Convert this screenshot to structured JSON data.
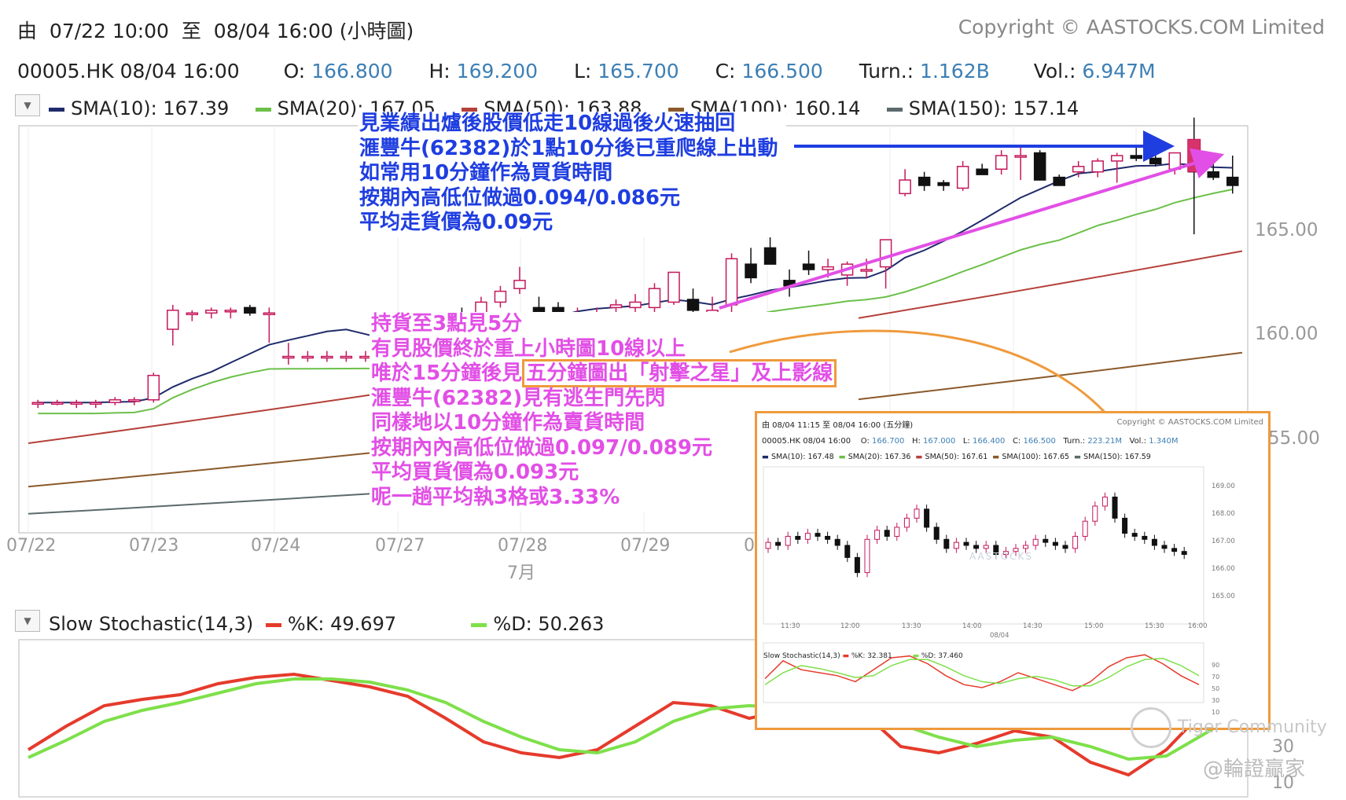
{
  "header": {
    "period_prefix": "由",
    "period_start": "07/22 10:00",
    "period_mid": "至",
    "period_end": "08/04 16:00 (小時圖)",
    "copyright": "Copyright © AASTOCKS.COM Limited",
    "symbol_time": "00005.HK 08/04 16:00",
    "open_label": "O:",
    "open_value": "166.800",
    "high_label": "H:",
    "high_value": "169.200",
    "low_label": "L:",
    "low_value": "165.700",
    "close_label": "C:",
    "close_value": "166.500",
    "turnover_label": "Turn.:",
    "turnover_value": "1.162B",
    "volume_label": "Vol.:",
    "volume_value": "6.947M"
  },
  "legend": [
    {
      "label": "SMA(10): 167.39",
      "color": "#1f2b6b"
    },
    {
      "label": "SMA(20): 167.05",
      "color": "#6cc04a"
    },
    {
      "label": "SMA(50): 163.88",
      "color": "#b5413a"
    },
    {
      "label": "SMA(100): 160.14",
      "color": "#8a5a2b"
    },
    {
      "label": "SMA(150): 157.14",
      "color": "#5b6b6b"
    }
  ],
  "annotation_blue": [
    "見業績出爐後股價低走10線過後火速抽回",
    "滙豐牛(62382)於1點10分後已重爬線上出動",
    "如常用10分鐘作為買貨時間",
    "按期內高低位做過0.094/0.086元",
    "平均走貨價為0.09元"
  ],
  "annotation_pink": {
    "line1": "持貨至3點見5分",
    "line2": "有見股價終於重上小時圖10線以上",
    "line3_a": "唯於15分鐘後見",
    "line3_b": "五分鐘圖出「射擊之星」及上影線",
    "line4": "滙豐牛(62382)見有逃生門先閃",
    "line5": "同樣地以10分鐘作為賣貨時間",
    "line6": "按期內內高低位做過0.097/0.089元",
    "line7": "平均買貨價為0.093元",
    "line8": "呢一趟平均執3格或3.33%"
  },
  "x_axis": {
    "labels": [
      "07/22",
      "07/23",
      "07/24",
      "07/27",
      "07/28",
      "07/29",
      "0"
    ],
    "month_label": "7月"
  },
  "y_axis": {
    "labels": [
      "165.00",
      "160.00",
      "55.00"
    ]
  },
  "stochastic": {
    "dropdown": "▼",
    "title": "Slow Stochastic(14,3)",
    "k_label": "%K: 49.697",
    "k_color": "#e53b2c",
    "d_label": "%D: 50.263",
    "d_color": "#7ee04a",
    "y_labels": [
      "30",
      "10"
    ]
  },
  "inset": {
    "title": "由 08/04 11:15 至 08/04 16:00 (五分鐘)",
    "copyright": "Copyright © AASTOCKS.COM Limited",
    "symbol_time": "00005.HK 08/04 16:00",
    "open": "O: ",
    "open_v": "166.700",
    "high": "H: ",
    "high_v": "167.000",
    "low": "L: ",
    "low_v": "166.400",
    "close": "C: ",
    "close_v": "166.500",
    "turn": "Turn.: ",
    "turn_v": "223.21M",
    "vol": "Vol.: ",
    "vol_v": "1.340M",
    "legend": [
      "SMA(10): 167.48",
      "SMA(20): 167.36",
      "SMA(50): 167.61",
      "SMA(100): 167.65",
      "SMA(150): 167.59"
    ],
    "y_labels": [
      "169.00",
      "168.00",
      "167.00",
      "166.00",
      "165.00"
    ],
    "x_labels": [
      "11:30",
      "12:00",
      "13:30",
      "14:00",
      "14:30",
      "15:00",
      "15:30",
      "16:00"
    ],
    "date_label": "08/04",
    "stoch_title": "Slow Stochastic(14,3)",
    "stoch_k": "%K: 32.381",
    "stoch_d": "%D: 37.460",
    "stoch_y": [
      "90",
      "70",
      "50",
      "30",
      "10"
    ],
    "watermark": "AASTOCKS"
  },
  "watermarks": {
    "tiger": "Tiger Community",
    "author": "@輪證贏家"
  },
  "chart_data": [
    {
      "type": "candlestick",
      "title": "00005.HK hourly",
      "period": "07/22 10:00 – 08/04 16:00",
      "ylim": [
        153.5,
        168.5
      ],
      "candles": [
        [
          158.3,
          158.4,
          158.1,
          158.3
        ],
        [
          158.3,
          158.4,
          158.2,
          158.3
        ],
        [
          158.3,
          158.4,
          158.1,
          158.3
        ],
        [
          158.3,
          158.4,
          158.1,
          158.3
        ],
        [
          158.3,
          158.5,
          158.2,
          158.4
        ],
        [
          158.4,
          158.5,
          158.2,
          158.4
        ],
        [
          158.4,
          159.4,
          158.3,
          159.3
        ],
        [
          161.0,
          161.9,
          160.4,
          161.7
        ],
        [
          161.6,
          161.7,
          161.3,
          161.6
        ],
        [
          161.6,
          161.8,
          161.4,
          161.7
        ],
        [
          161.7,
          161.8,
          161.4,
          161.7
        ],
        [
          161.8,
          161.9,
          161.5,
          161.6
        ],
        [
          161.6,
          161.8,
          160.5,
          161.6
        ],
        [
          160.0,
          160.5,
          159.7,
          160.0
        ],
        [
          160.0,
          160.2,
          159.8,
          160.0
        ],
        [
          160.0,
          160.2,
          159.8,
          160.0
        ],
        [
          160.0,
          160.2,
          159.8,
          160.0
        ],
        [
          160.0,
          160.2,
          159.8,
          160.0
        ],
        [
          160.0,
          160.3,
          159.7,
          159.8
        ],
        [
          160.5,
          161.0,
          160.2,
          160.6
        ],
        [
          161.2,
          161.5,
          160.9,
          161.4
        ],
        [
          161.2,
          161.6,
          161.0,
          161.5
        ],
        [
          161.6,
          161.8,
          161.2,
          161.3
        ],
        [
          161.4,
          162.2,
          161.3,
          162.0
        ],
        [
          162.0,
          162.6,
          161.8,
          162.4
        ],
        [
          162.5,
          163.3,
          162.3,
          162.8
        ],
        [
          161.8,
          162.2,
          161.5,
          161.6
        ],
        [
          161.8,
          162.0,
          161.4,
          161.4
        ],
        [
          161.4,
          161.8,
          161.3,
          161.6
        ],
        [
          161.6,
          161.8,
          161.4,
          161.6
        ],
        [
          161.8,
          162.1,
          161.6,
          161.9
        ],
        [
          161.8,
          162.3,
          161.6,
          162.0
        ],
        [
          161.8,
          162.7,
          161.5,
          162.5
        ],
        [
          162.0,
          163.0,
          161.9,
          163.1
        ],
        [
          162.1,
          162.5,
          161.6,
          161.7
        ],
        [
          161.6,
          162.2,
          161.4,
          161.7
        ],
        [
          161.9,
          163.8,
          161.6,
          163.6
        ],
        [
          163.4,
          164.0,
          162.7,
          162.9
        ],
        [
          164.0,
          164.8,
          163.8,
          163.4
        ],
        [
          162.8,
          163.2,
          162.2,
          162.6
        ],
        [
          163.4,
          163.9,
          163.0,
          163.2
        ],
        [
          163.2,
          163.6,
          162.9,
          163.3
        ],
        [
          163.0,
          163.5,
          162.6,
          163.4
        ],
        [
          163.2,
          163.6,
          162.9,
          163.2
        ],
        [
          163.3,
          164.3,
          162.5,
          164.3
        ],
        [
          166.0,
          166.9,
          165.9,
          166.5
        ],
        [
          166.6,
          166.8,
          166.1,
          166.3
        ],
        [
          166.4,
          166.5,
          166.1,
          166.3
        ],
        [
          166.2,
          167.2,
          166.1,
          167.0
        ],
        [
          166.9,
          167.1,
          166.7,
          166.7
        ],
        [
          166.9,
          167.6,
          166.7,
          167.4
        ],
        [
          167.4,
          167.7,
          166.5,
          167.4
        ],
        [
          167.5,
          167.6,
          166.5,
          166.5
        ],
        [
          166.6,
          166.7,
          166.3,
          166.3
        ],
        [
          166.8,
          167.2,
          166.6,
          167.0
        ],
        [
          166.8,
          167.3,
          166.6,
          167.2
        ],
        [
          167.2,
          167.5,
          166.4,
          167.4
        ],
        [
          167.4,
          167.8,
          167.2,
          167.3
        ],
        [
          167.3,
          167.5,
          167.0,
          167.1
        ],
        [
          166.9,
          167.5,
          166.7,
          167.5
        ],
        [
          167.7,
          168.8,
          164.5,
          166.8
        ],
        [
          166.8,
          167.2,
          166.5,
          166.6
        ],
        [
          166.6,
          167.4,
          166.0,
          166.3
        ]
      ],
      "series": [
        {
          "name": "SMA(10)",
          "end_value": 167.39
        },
        {
          "name": "SMA(20)",
          "end_value": 167.05
        },
        {
          "name": "SMA(50)",
          "end_value": 163.88
        },
        {
          "name": "SMA(100)",
          "end_value": 160.14
        },
        {
          "name": "SMA(150)",
          "end_value": 157.14
        }
      ],
      "x_categories": [
        "07/22",
        "07/23",
        "07/24",
        "07/27",
        "07/28",
        "07/29"
      ],
      "y_ticks": [
        160.0,
        165.0
      ]
    },
    {
      "type": "line",
      "title": "Slow Stochastic(14,3)",
      "ylim": [
        0,
        100
      ],
      "series": [
        {
          "name": "%K",
          "values": [
            30,
            45,
            58,
            62,
            65,
            72,
            76,
            78,
            74,
            70,
            64,
            50,
            35,
            28,
            25,
            30,
            45,
            60,
            58,
            50,
            55,
            66,
            54,
            32,
            28,
            34,
            42,
            38,
            22,
            14,
            30,
            55,
            68
          ]
        },
        {
          "name": "%D",
          "values": [
            25,
            36,
            48,
            55,
            60,
            66,
            72,
            75,
            75,
            73,
            68,
            60,
            48,
            38,
            30,
            28,
            35,
            48,
            56,
            58,
            57,
            60,
            58,
            46,
            38,
            32,
            36,
            38,
            32,
            24,
            26,
            40,
            55
          ]
        }
      ]
    }
  ]
}
